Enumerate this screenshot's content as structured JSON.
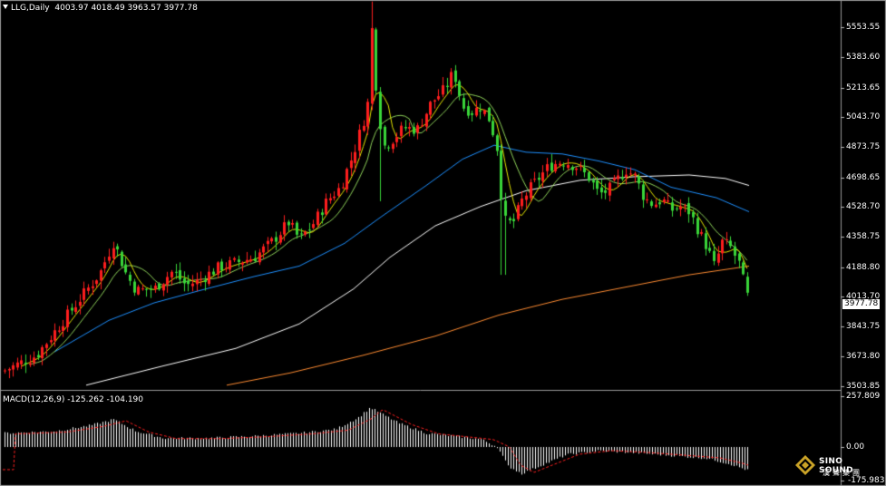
{
  "header": {
    "symbol_label": "LLG,Daily",
    "ohlc_label": "4003.97 4018.49 3963.57 3977.78"
  },
  "macd_header": {
    "label": "MACD(12,26,9) -125.262 -104.190"
  },
  "price_axis": [
    "5553.55",
    "5383.60",
    "5213.65",
    "5043.70",
    "4873.75",
    "4698.65",
    "4528.70",
    "4358.75",
    "4188.80",
    "4013.70",
    "3843.75",
    "3673.80",
    "3503.85"
  ],
  "macd_axis": [
    "257.809",
    "0.00",
    "-175.983"
  ],
  "current_price": "3977.78",
  "logo": {
    "name": "SINO SOUND",
    "sub": "漢聲集團"
  },
  "colors": {
    "background": "#000000",
    "bull_candle": "#ff1e1e",
    "bear_candle": "#39d639",
    "ma_short": "#e6e600",
    "ma_mid": "#8fd35a",
    "ma_60": "#1e90ff",
    "ma_120": "#ffffff",
    "ma_250": "#ff8c32",
    "macd_signal": "#ff2020"
  },
  "chart_data": [
    {
      "type": "candlestick",
      "title": "LLG,Daily",
      "ylim": [
        3503.85,
        5553.55
      ],
      "last_close": 3977.78,
      "note_series": [
        "ma_short",
        "ma_mid",
        "ma_60",
        "ma_120",
        "ma_250"
      ]
    },
    {
      "type": "bar",
      "title": "MACD(12,26,9)",
      "macd": -125.262,
      "signal": -104.19,
      "ylim": [
        -175.983,
        257.809
      ]
    }
  ]
}
